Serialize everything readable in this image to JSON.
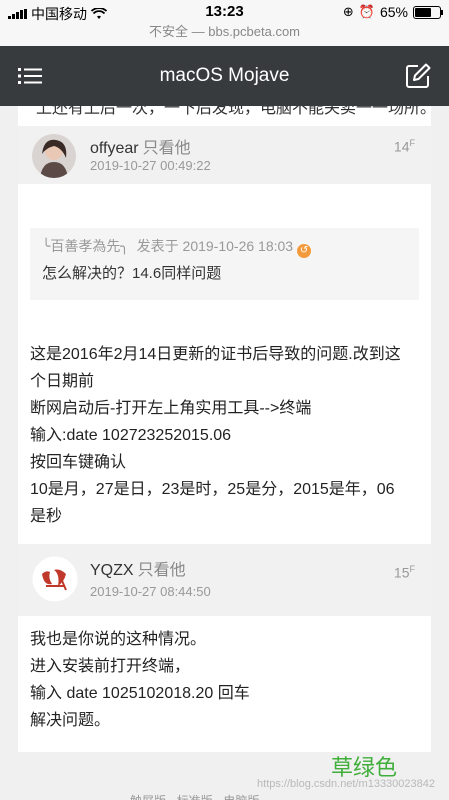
{
  "status_bar": {
    "carrier": "中国移动",
    "time": "13:23",
    "battery": "65%"
  },
  "url_bar": {
    "security": "不安全",
    "separator": " — ",
    "domain": "bbs.pcbeta.com"
  },
  "header": {
    "title": "macOS Mojave"
  },
  "cut_text": "上还有上后一次，一下后发现，电脑不能关卖一一场所。",
  "posts": [
    {
      "username": "offyear",
      "only_view": "只看他",
      "date": "2019-10-27 00:49:22",
      "floor": "14",
      "floor_suffix": "F",
      "quote": {
        "author": "╰百善孝為先╮",
        "posted_label": "发表于",
        "date": "2019-10-26 18:03",
        "text": "怎么解决的？14.6同样问题"
      },
      "lines": [
        "这是2016年2月14日更新的证书后导致的问题.改到这",
        "个日期前",
        "断网启动后-打开左上角实用工具-->终端",
        "输入:date 102723252015.06",
        "按回车键确认",
        "10是月，27是日，23是时，25是分，2015是年，06",
        "是秒"
      ]
    },
    {
      "username": "YQZX",
      "only_view": "只看他",
      "date": "2019-10-27 08:44:50",
      "floor": "15",
      "floor_suffix": "F",
      "lines": [
        "我也是你说的这种情况。",
        "进入安装前打开终端，",
        "输入 date 1025102018.20 回车",
        "解决问题。"
      ]
    }
  ],
  "overlay_label": "草绿色",
  "watermark": "https://blog.csdn.net/m13330023842",
  "footer": "触屏版 · 标准版 · 电脑版",
  "colors": {
    "header_bg": "#373b3e",
    "page_bg": "#f0f0f0",
    "green_label": "#3fae3a",
    "quote_icon": "#f39a3d"
  }
}
